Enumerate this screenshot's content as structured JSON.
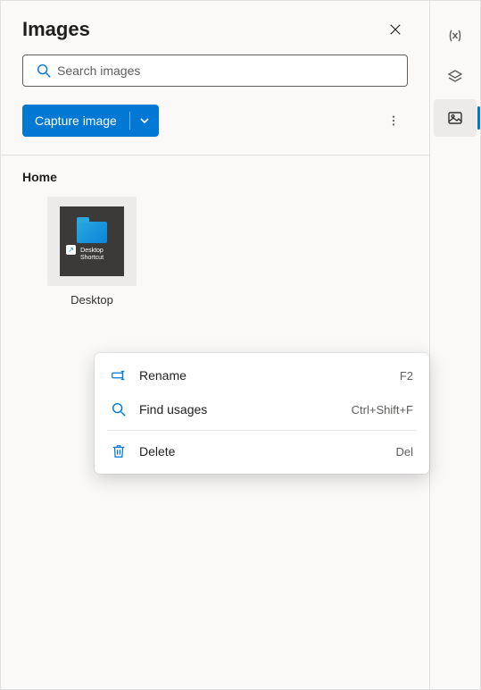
{
  "header": {
    "title": "Images"
  },
  "search": {
    "placeholder": "Search images"
  },
  "toolbar": {
    "capture_label": "Capture image"
  },
  "section": {
    "title": "Home",
    "items": [
      {
        "label": "Desktop",
        "thumb_text_1": "Desktop",
        "thumb_text_2": "Shortcut"
      }
    ]
  },
  "context_menu": {
    "items": [
      {
        "icon": "rename-icon",
        "label": "Rename",
        "shortcut": "F2"
      },
      {
        "icon": "search-icon",
        "label": "Find usages",
        "shortcut": "Ctrl+Shift+F"
      },
      {
        "icon": "trash-icon",
        "label": "Delete",
        "shortcut": "Del"
      }
    ]
  },
  "rail": {
    "items": [
      {
        "name": "variables",
        "active": false
      },
      {
        "name": "layers",
        "active": false
      },
      {
        "name": "images",
        "active": true
      }
    ]
  }
}
